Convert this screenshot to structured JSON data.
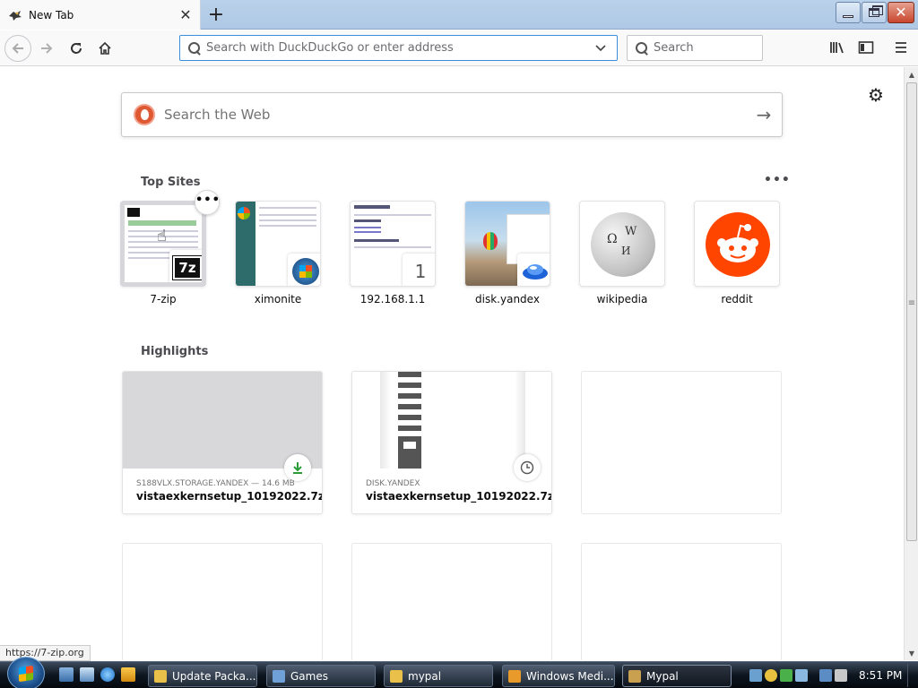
{
  "browser": {
    "tab_title": "New Tab",
    "url_placeholder": "Search with DuckDuckGo or enter address",
    "search_placeholder": "Search",
    "tab_close_glyph": "✕",
    "newtab_glyph": "+",
    "icons": {
      "back": "arrow-left-icon",
      "forward": "arrow-right-icon",
      "reload": "reload-icon",
      "home": "home-icon",
      "library": "library-icon",
      "sidebar": "sidebar-icon",
      "menu": "hamburger-menu-icon"
    }
  },
  "newtab": {
    "websearch_placeholder": "Search the Web",
    "top_sites_title": "Top Sites",
    "highlights_title": "Highlights",
    "top_sites": [
      {
        "label": "7-zip",
        "badge": "7z"
      },
      {
        "label": "ximonite"
      },
      {
        "label": "192.168.1.1",
        "badge": "1"
      },
      {
        "label": "disk.yandex"
      },
      {
        "label": "wikipedia"
      },
      {
        "label": "reddit"
      }
    ],
    "highlights": [
      {
        "host": "S188VLX.STORAGE.YANDEX — 14.6 MB",
        "title": "vistaexkernsetup_10192022.7z",
        "icon": "download-icon"
      },
      {
        "host": "DISK.YANDEX",
        "title": "vistaexkernsetup_10192022.7z ...",
        "icon": "clock-icon"
      }
    ],
    "status_url": "https://7-zip.org"
  },
  "taskbar": {
    "buttons": [
      {
        "label": "Update Packa...",
        "icon_color": "#e8c04a"
      },
      {
        "label": "Games",
        "icon_color": "#6fa0d8"
      },
      {
        "label": "mypal",
        "icon_color": "#e8c04a"
      },
      {
        "label": "Windows Medi...",
        "icon_color": "#e89a2a"
      },
      {
        "label": "Mypal",
        "icon_color": "#c9a050"
      }
    ],
    "clock": "8:51 PM"
  },
  "colors": {
    "accent": "#3a8fdc",
    "reddit": "#ff4500",
    "ddg": "#de5833"
  }
}
